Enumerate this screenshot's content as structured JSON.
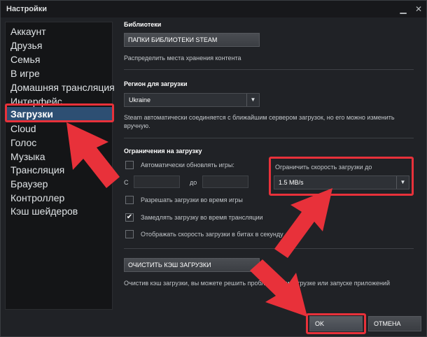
{
  "window": {
    "title": "Настройки",
    "minimize_icon": "minimize-icon",
    "close_icon": "close-icon"
  },
  "sidebar": {
    "items": [
      {
        "label": "Аккаунт"
      },
      {
        "label": "Друзья"
      },
      {
        "label": "Семья"
      },
      {
        "label": "В игре"
      },
      {
        "label": "Домашняя трансляция"
      },
      {
        "label": "Интерфейс"
      },
      {
        "label": "Загрузки",
        "active": true
      },
      {
        "label": "Cloud"
      },
      {
        "label": "Голос"
      },
      {
        "label": "Музыка"
      },
      {
        "label": "Трансляция"
      },
      {
        "label": "Браузер"
      },
      {
        "label": "Контроллер"
      },
      {
        "label": "Кэш шейдеров"
      }
    ]
  },
  "libraries": {
    "title": "Библиотеки",
    "button_label": "ПАПКИ БИБЛИОТЕКИ STEAM",
    "description": "Распределить места хранения контента"
  },
  "region": {
    "title": "Регион для загрузки",
    "selected": "Ukraine",
    "description": "Steam автоматически соединяется с ближайшим сервером загрузок, но его можно изменить вручную."
  },
  "limits": {
    "title": "Ограничения на загрузку",
    "auto_update_label": "Автоматически обновлять игры:",
    "auto_update_checked": false,
    "from_label": "С",
    "to_label": "до",
    "speed_limit_label": "Ограничить скорость загрузки до",
    "speed_limit_value": "1.5 MB/s",
    "allow_during_games_label": "Разрешать загрузки во время игры",
    "allow_during_games_checked": false,
    "throttle_streaming_label": "Замедлять загрузку во время трансляции",
    "throttle_streaming_checked": true,
    "show_bits_label": "Отображать скорость загрузки в битах в секунду",
    "show_bits_checked": false
  },
  "cache": {
    "button_label": "ОЧИСТИТЬ КЭШ ЗАГРУЗКИ",
    "description": "Очистив кэш загрузки, вы можете решить проблемы при загрузке или запуске приложений"
  },
  "footer": {
    "ok_label": "OK",
    "cancel_label": "ОТМЕНА"
  },
  "colors": {
    "background": "#202226",
    "sidebar_active": "#2d4f73",
    "highlight": "#e8313a"
  }
}
